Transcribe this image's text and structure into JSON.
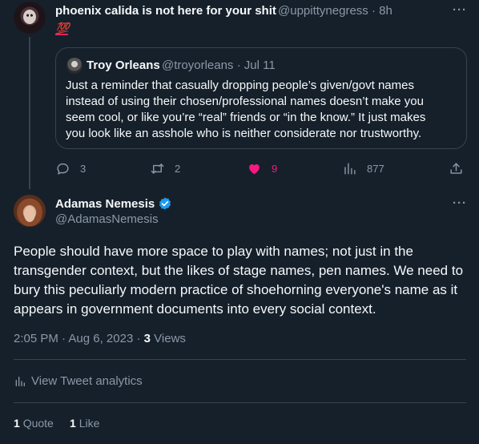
{
  "parent_tweet": {
    "author_name": "phoenix calida is not here for your shit",
    "author_handle": "@uppittynegress",
    "time": "8h",
    "text": "💯",
    "quoted": {
      "author_name": "Troy Orleans",
      "author_handle": "@troyorleans",
      "date": "Jul 11",
      "text": "Just a reminder that casually dropping people’s given/govt names instead of using their chosen/professional names doesn’t make you seem cool, or like you’re “real” friends or “in the know.” It just makes you look like an asshole who is neither considerate nor trustworthy."
    },
    "actions": {
      "replies": "3",
      "retweets": "2",
      "likes": "9",
      "views": "877"
    }
  },
  "main_tweet": {
    "author_name": "Adamas Nemesis",
    "author_handle": "@AdamasNemesis",
    "verified": true,
    "text": "People should have more space to play with names; not just in the transgender context, but the likes of stage names, pen names. We need to bury this peculiarly modern practice of shoehorning everyone's name as it appears in government documents into every social context.",
    "time": "2:05 PM",
    "date": "Aug 6, 2023",
    "views_count": "3",
    "views_label": "Views",
    "analytics_label": "View Tweet analytics",
    "quote_count": "1",
    "quote_label": "Quote",
    "like_count": "1",
    "like_label": "Like"
  },
  "colors": {
    "background": "#15202b",
    "secondary_text": "#8b98a5",
    "like_active": "#f91880",
    "verified": "#1d9bf0",
    "border": "#38444d"
  }
}
